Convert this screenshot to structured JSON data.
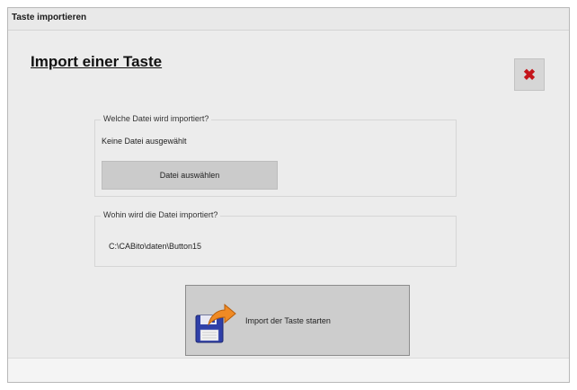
{
  "window": {
    "title": "Taste importieren"
  },
  "dialog": {
    "heading": "Import einer Taste",
    "close_icon": "close-x-icon",
    "close_color": "#c4141a"
  },
  "source_group": {
    "legend": "Welche Datei wird importiert?",
    "status": "Keine Datei ausgewählt",
    "button_label": "Datei auswählen"
  },
  "target_group": {
    "legend": "Wohin wird die Datei importiert?",
    "path": "C:\\CABito\\daten\\Button15"
  },
  "start_button": {
    "label": "Import der Taste starten",
    "icon": "floppy-disk-import-icon"
  }
}
